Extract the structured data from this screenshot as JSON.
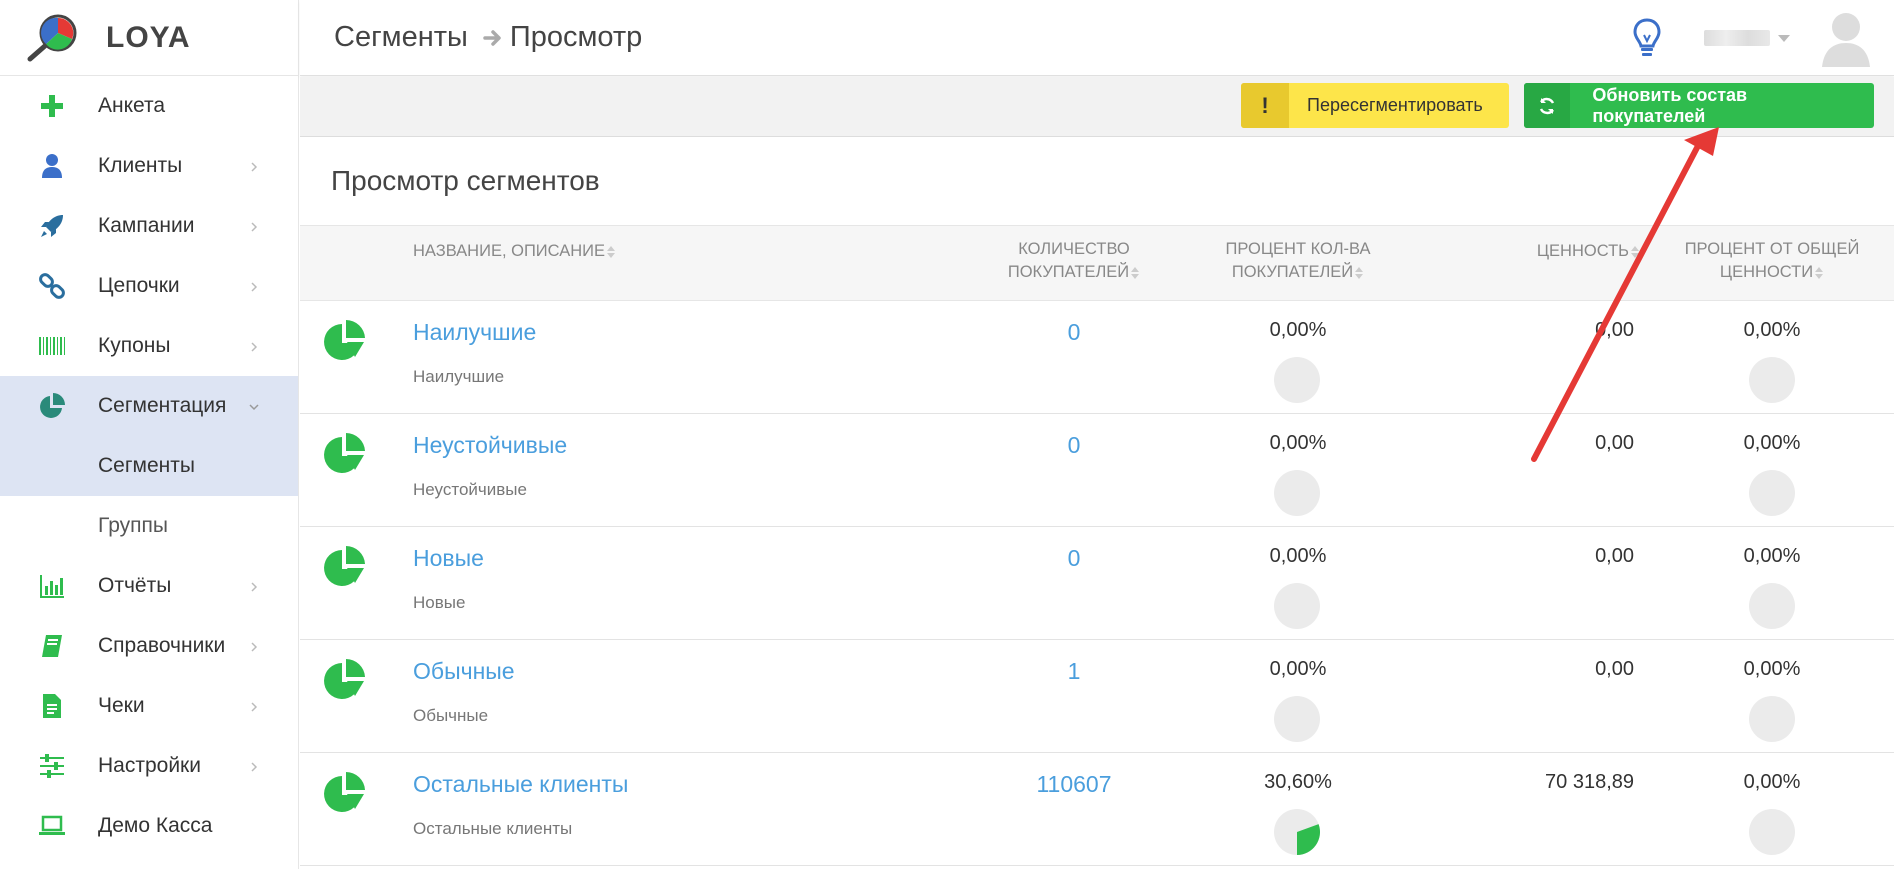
{
  "brand": {
    "name": "LOYA"
  },
  "sidebar": {
    "items": [
      {
        "label": "Анкета",
        "icon": "plus-icon",
        "color": "#2fbc4e",
        "chevron": false
      },
      {
        "label": "Клиенты",
        "icon": "user-icon",
        "color": "#3b6fc9",
        "chevron": true
      },
      {
        "label": "Кампании",
        "icon": "rocket-icon",
        "color": "#2a6e9e",
        "chevron": true
      },
      {
        "label": "Цепочки",
        "icon": "chain-icon",
        "color": "#2a6e9e",
        "chevron": true
      },
      {
        "label": "Купоны",
        "icon": "barcode-icon",
        "color": "#2fbc4e",
        "chevron": true
      },
      {
        "label": "Сегментация",
        "icon": "pie-chart-icon",
        "color": "#2a8a7a",
        "chevron": true,
        "active": true,
        "expanded": true
      },
      {
        "label": "Сегменты",
        "sub": true,
        "active": true
      },
      {
        "label": "Группы",
        "sub": true
      },
      {
        "label": "Отчёты",
        "icon": "bar-chart-icon",
        "color": "#2fbc4e",
        "chevron": true
      },
      {
        "label": "Справочники",
        "icon": "book-icon",
        "color": "#2fbc4e",
        "chevron": true
      },
      {
        "label": "Чеки",
        "icon": "receipt-icon",
        "color": "#2fbc4e",
        "chevron": true
      },
      {
        "label": "Настройки",
        "icon": "sliders-icon",
        "color": "#2fbc4e",
        "chevron": true
      },
      {
        "label": "Демо Касса",
        "icon": "laptop-icon",
        "color": "#2fbc4e",
        "chevron": false
      }
    ]
  },
  "header": {
    "breadcrumb": [
      "Сегменты",
      "Просмотр"
    ]
  },
  "toolbar": {
    "resegment_label": "Пересегментировать",
    "resegment_icon_text": "!",
    "update_label": "Обновить состав покупателей"
  },
  "main": {
    "title": "Просмотр сегментов",
    "columns": {
      "name": "НАЗВАНИЕ, ОПИСАНИЕ",
      "count_line1": "КОЛИЧЕСТВО",
      "count_line2": "ПОКУПАТЕЛЕЙ",
      "pct_line1": "ПРОЦЕНТ КОЛ-ВА",
      "pct_line2": "ПОКУПАТЕЛЕЙ",
      "value": "ЦЕННОСТЬ",
      "valpct_line1": "ПРОЦЕНТ ОТ ОБЩЕЙ",
      "valpct_line2": "ЦЕННОСТИ"
    },
    "rows": [
      {
        "name": "Наилучшие",
        "desc": "Наилучшие",
        "count": "0",
        "pct": "0,00%",
        "pct_fraction": 0,
        "value": "0,00",
        "valpct": "0,00%",
        "valpct_fraction": 0
      },
      {
        "name": "Неустойчивые",
        "desc": "Неустойчивые",
        "count": "0",
        "pct": "0,00%",
        "pct_fraction": 0,
        "value": "0,00",
        "valpct": "0,00%",
        "valpct_fraction": 0
      },
      {
        "name": "Новые",
        "desc": "Новые",
        "count": "0",
        "pct": "0,00%",
        "pct_fraction": 0,
        "value": "0,00",
        "valpct": "0,00%",
        "valpct_fraction": 0
      },
      {
        "name": "Обычные",
        "desc": "Обычные",
        "count": "1",
        "pct": "0,00%",
        "pct_fraction": 0,
        "value": "0,00",
        "valpct": "0,00%",
        "valpct_fraction": 0
      },
      {
        "name": "Остальные клиенты",
        "desc": "Остальные клиенты",
        "count": "110607",
        "pct": "30,60%",
        "pct_fraction": 0.306,
        "value": "70 318,89",
        "valpct": "0,00%",
        "valpct_fraction": 0
      }
    ]
  },
  "colors": {
    "accent_green": "#2fbc4e",
    "link_blue": "#4a9edd",
    "warning_yellow": "#fde54a",
    "active_bg": "#dde4f3",
    "annotation_red": "#e53935"
  }
}
